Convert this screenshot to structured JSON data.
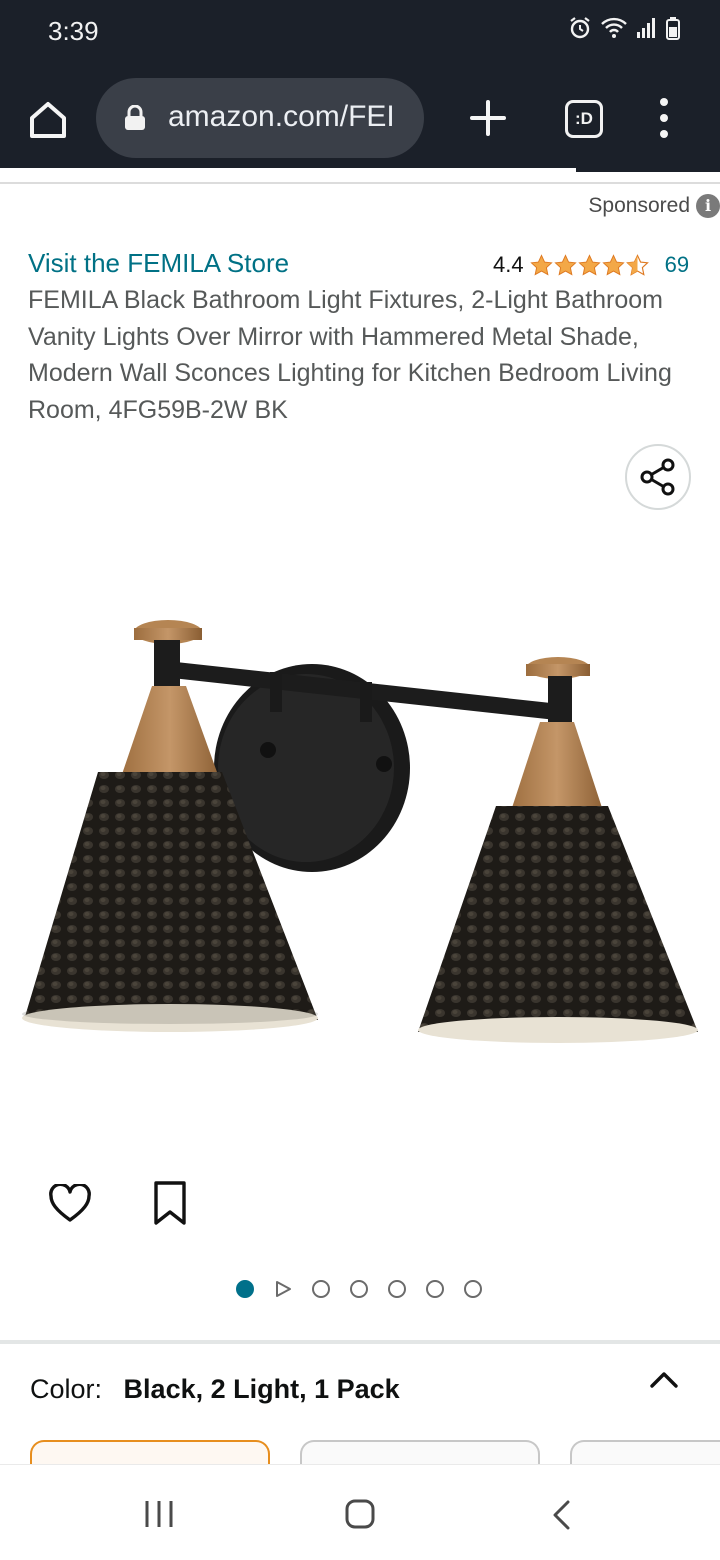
{
  "status_bar": {
    "time": "3:39"
  },
  "browser": {
    "url": "amazon.com/FEI",
    "tabs_label": ":D"
  },
  "sponsored": {
    "label": "Sponsored",
    "info_glyph": "i"
  },
  "product": {
    "store_link": "Visit the FEMILA Store",
    "rating_value": "4.4",
    "rating_stars": 4.4,
    "rating_count": "69",
    "title": "FEMILA Black Bathroom Light Fixtures, 2-Light Bathroom Vanity Lights Over Mirror with Hammered Metal Shade, Modern Wall Sconces Lighting for Kitchen Bedroom Living Room, 4FG59B-2W BK",
    "image_count": 7,
    "active_image_index": 0
  },
  "variation": {
    "color_label": "Color:",
    "color_value": "Black, 2 Light, 1 Pack"
  },
  "colors": {
    "brand_link": "#007185",
    "star": "#f3a847",
    "active_dot": "#00708a",
    "selected_swatch_border": "#e78e1e",
    "chrome_bg": "#1b2029"
  },
  "icons": {
    "home": "home-icon",
    "lock": "lock-icon",
    "plus": "plus-icon",
    "menu": "more-vert-icon",
    "share": "share-icon",
    "heart": "heart-icon",
    "bookmark": "bookmark-icon",
    "collapse": "chevron-up-icon"
  }
}
